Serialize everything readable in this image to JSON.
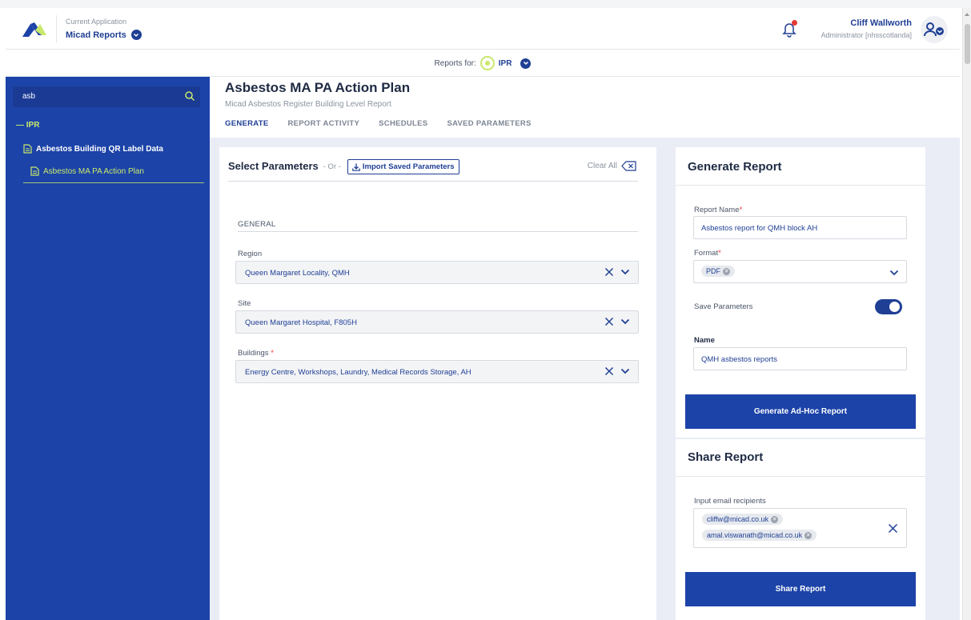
{
  "header": {
    "app_caption": "Current Application",
    "app_name": "Micad Reports",
    "user_name": "Cliff Wallworth",
    "user_role": "Administrator [nhsscotlanda]"
  },
  "reports_for": {
    "label": "Reports for:",
    "value": "IPR"
  },
  "sidebar": {
    "search_value": "asb",
    "root": "— IPR",
    "items": [
      {
        "label": "Asbestos Building QR Label Data"
      },
      {
        "label": "Asbestos MA PA Action Plan"
      }
    ]
  },
  "page": {
    "title": "Asbestos MA PA Action Plan",
    "subtitle": "Micad Asbestos Register Building Level Report",
    "tabs": [
      "GENERATE",
      "REPORT ACTIVITY",
      "SCHEDULES",
      "SAVED PARAMETERS"
    ],
    "active_tab": "GENERATE"
  },
  "parameters": {
    "title": "Select Parameters",
    "or_text": "- Or -",
    "import_label": "Import Saved Parameters",
    "clear_all": "Clear All",
    "section": "GENERAL",
    "fields": [
      {
        "label": "Region",
        "required": false,
        "value": "Queen Margaret Locality, QMH"
      },
      {
        "label": "Site",
        "required": false,
        "value": "Queen Margaret Hospital, F805H"
      },
      {
        "label": "Buildings",
        "required": true,
        "value": "Energy Centre, Workshops, Laundry, Medical Records Storage, AH"
      }
    ]
  },
  "generate": {
    "title": "Generate Report",
    "report_name_label": "Report Name",
    "report_name_value": "Asbestos report for QMH block AH",
    "format_label": "Format",
    "format_value": "PDF",
    "save_parameters_label": "Save Parameters",
    "save_parameters_on": true,
    "name_label": "Name",
    "name_value": "QMH asbestos reports",
    "button": "Generate Ad-Hoc Report"
  },
  "share": {
    "title": "Share Report",
    "recipients_label": "Input email recipients",
    "recipients": [
      "cliffw@micad.co.uk",
      "amal.viswanath@micad.co.uk"
    ],
    "button": "Share Report"
  },
  "required_marker": "*"
}
